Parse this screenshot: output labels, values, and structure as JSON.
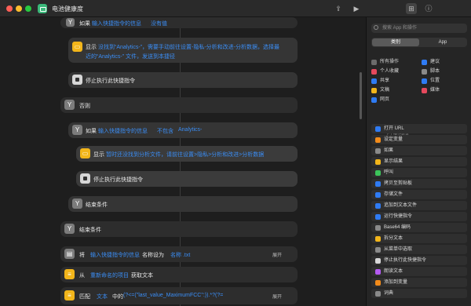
{
  "window": {
    "title": "电池健康度"
  },
  "blocks": {
    "if1": {
      "label": "如果",
      "condition": "输入快捷指令的信息",
      "rest": "没有值"
    },
    "show1": {
      "label": "显示",
      "text1": "没找到“Analytics-”，需要手动前往设置-隐私-分析和改进-分析数据，选择最",
      "text2": "近的“Analytics-” 文件，发送到本捷径"
    },
    "stop1": {
      "label": "停止执行此快捷指令"
    },
    "otherwise1": {
      "label": "否则"
    },
    "if2": {
      "label": "如果",
      "condition": "输入快捷指令的信息",
      "op": "不包含",
      "value": "Analytics-"
    },
    "show2": {
      "label": "显示",
      "text": "暂时还没找到分析文件，请前往设置>隐私>分析和改进>分析数据"
    },
    "stop2": {
      "label": "停止执行此快捷指令"
    },
    "end2": {
      "label": "结束条件"
    },
    "end1": {
      "label": "结束条件"
    },
    "set": {
      "label": "将",
      "token": "输入快捷指令的信息",
      "mid": "名称设为",
      "value": "名称 .txt",
      "expand": "展开"
    },
    "getfile": {
      "label": "从",
      "token": "重新命名的项目",
      "mid": "获取文本"
    },
    "match": {
      "label": "匹配",
      "token": "文本",
      "mid": "中的",
      "pattern": "(?<=(\"last_value_MaximumFCC\":)).*?(?=",
      "expand": "展开"
    }
  },
  "sidebar": {
    "search_placeholder": "搜索 App 和操作",
    "tabs": [
      "类别",
      "App"
    ],
    "categories": [
      {
        "label": "所有操作",
        "color": "#6b6b6b"
      },
      {
        "label": "建议",
        "color": "#2f7bf3"
      },
      {
        "label": "个人收藏",
        "color": "#e5495d"
      },
      {
        "label": "脚本",
        "color": "#8a8a8a"
      },
      {
        "label": "共享",
        "color": "#2f7bf3"
      },
      {
        "label": "位置",
        "color": "#2f7bf3"
      },
      {
        "label": "文稿",
        "color": "#f2b51a"
      },
      {
        "label": "媒体",
        "color": "#e5495d"
      },
      {
        "label": "网页",
        "color": "#2f7bf3"
      }
    ],
    "section_header": "下个操作建议",
    "actions": [
      {
        "label": "打开 URL",
        "color": "#2f7bf3"
      },
      {
        "label": "设定变量",
        "color": "#f28b1a"
      },
      {
        "label": "如果",
        "color": "#8a8a8a"
      },
      {
        "label": "显示结果",
        "color": "#f2b51a"
      },
      {
        "label": "呼叫",
        "color": "#3cc45a"
      },
      {
        "label": "拷贝至剪贴板",
        "color": "#2f7bf3"
      },
      {
        "label": "存储文件",
        "color": "#2f7bf3"
      },
      {
        "label": "追加到文本文件",
        "color": "#2f7bf3"
      },
      {
        "label": "运行快捷指令",
        "color": "#2f7bf3"
      },
      {
        "label": "Base64 编码",
        "color": "#8a8a8a"
      },
      {
        "label": "拆分文本",
        "color": "#f2b51a"
      },
      {
        "label": "从菜单中选取",
        "color": "#8a8a8a"
      },
      {
        "label": "停止执行此快捷指令",
        "color": "#d7d7d7"
      },
      {
        "label": "朗读文本",
        "color": "#b45af2"
      },
      {
        "label": "添加到变量",
        "color": "#f28b1a"
      },
      {
        "label": "词典",
        "color": "#8a8a8a"
      }
    ]
  }
}
